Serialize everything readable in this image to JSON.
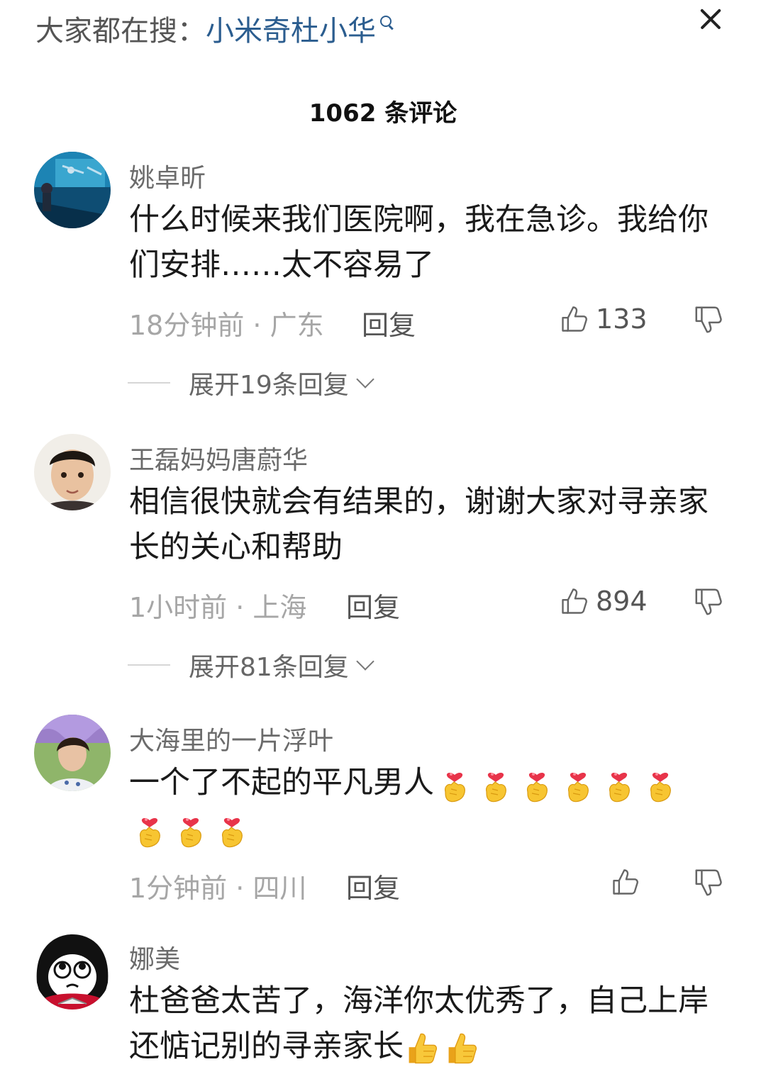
{
  "header": {
    "search_prefix": "大家都在搜：",
    "search_term": "小米奇杜小华",
    "comment_count": "1062 条评论"
  },
  "colors": {
    "link": "#2b5d8f",
    "meta": "#a6a6a6"
  },
  "icons": [
    "search-icon",
    "close-icon",
    "thumbs-up-icon",
    "thumbs-down-icon",
    "chevron-down-icon",
    "finger-heart-emoji",
    "thumbs-up-emoji"
  ],
  "comments": [
    {
      "user": "姚卓昕",
      "text": "什么时候来我们医院啊，我在急诊。我给你们安排……太不容易了",
      "meta": "18分钟前 · 广东",
      "reply": "回复",
      "likes": "133",
      "expand": "展开19条回复"
    },
    {
      "user": "王磊妈妈唐蔚华",
      "text": "相信很快就会有结果的，谢谢大家对寻亲家长的关心和帮助",
      "meta": "1小时前 · 上海",
      "reply": "回复",
      "likes": "894",
      "expand": "展开81条回复"
    },
    {
      "user": "大海里的一片浮叶",
      "text": "一个了不起的平凡男人",
      "meta": "1分钟前 · 四川",
      "reply": "回复",
      "likes": ""
    },
    {
      "user": "娜美",
      "text": "杜爸爸太苦了，海洋你太优秀了，自己上岸还惦记别的寻亲家长"
    }
  ]
}
